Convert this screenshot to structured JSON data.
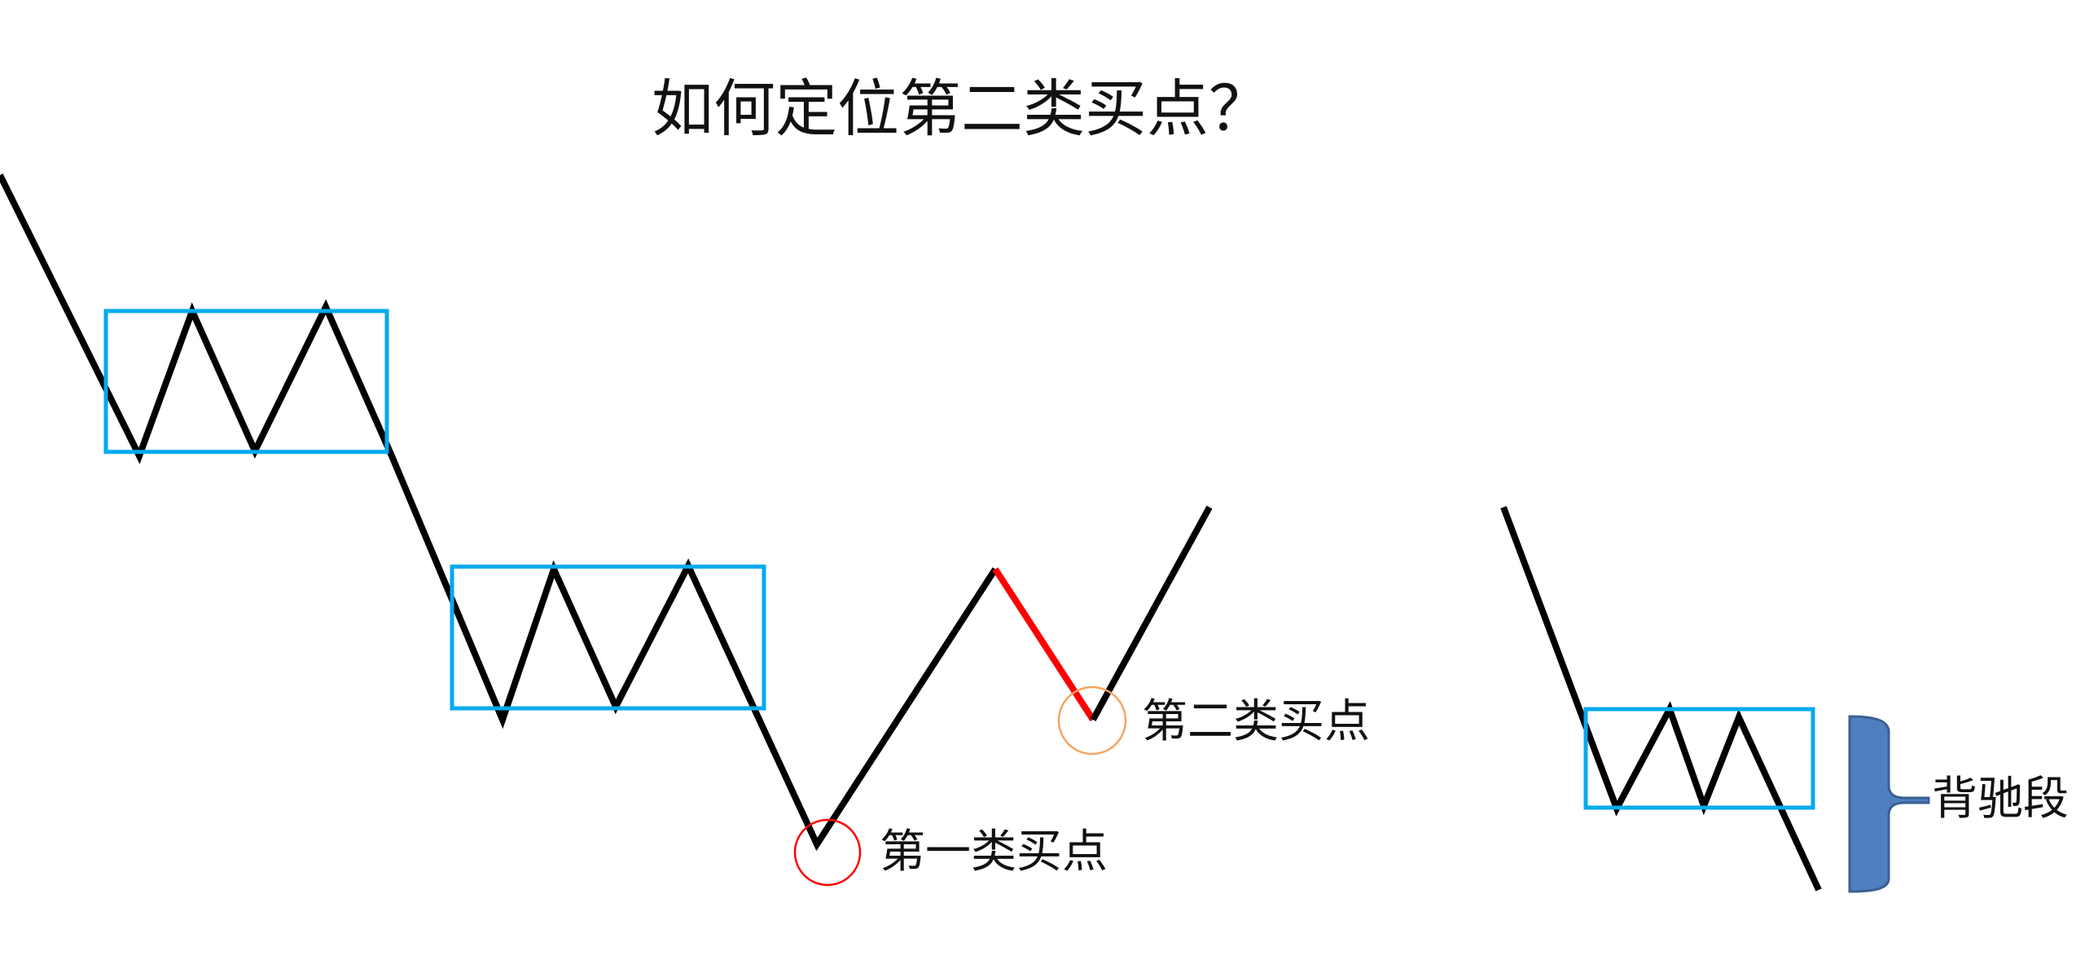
{
  "title": "如何定位第二类买点？",
  "labels": {
    "first_buy": "第一类买点",
    "second_buy": "第二类买点",
    "divergence": "背驰段"
  },
  "colors": {
    "line": "#000000",
    "center_box": "#00aaee",
    "second_buy_pullback": "#ff0000",
    "first_buy_marker": "#ff0000",
    "second_buy_marker": "#f4a460",
    "divergence_brace": "#4f7fbf"
  }
}
